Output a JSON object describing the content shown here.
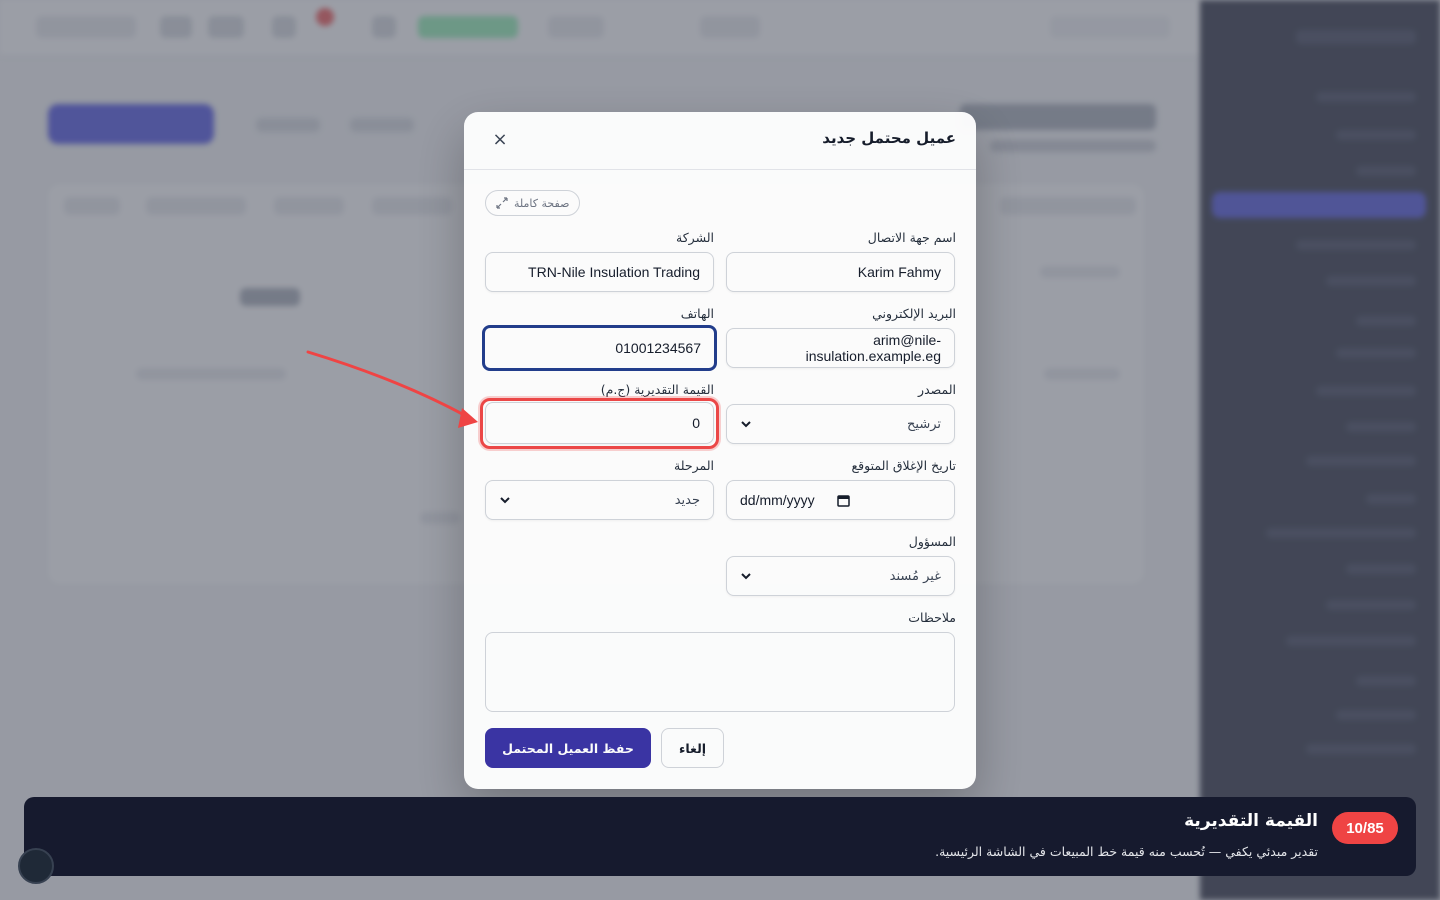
{
  "modal": {
    "title": "عميل محتمل جديد",
    "close_icon": "×",
    "fullpage_label": "صفحة كاملة",
    "fields": {
      "contact_name": {
        "label": "اسم جهة الاتصال",
        "value": "Karim Fahmy"
      },
      "company": {
        "label": "الشركة",
        "value": "TRN-Nile Insulation Trading"
      },
      "email": {
        "label": "البريد الإلكتروني",
        "value": "arim@nile-insulation.example.eg"
      },
      "phone": {
        "label": "الهاتف",
        "value": "01001234567"
      },
      "source": {
        "label": "المصدر",
        "value": "ترشيح"
      },
      "estimated_value": {
        "label": "القيمة التقديرية (ج.م)",
        "value": "0"
      },
      "expected_close": {
        "label": "تاريخ الإغلاق المتوقع",
        "placeholder": "dd/mm/yyyy"
      },
      "stage": {
        "label": "المرحلة",
        "value": "جديد"
      },
      "owner": {
        "label": "المسؤول",
        "value": "غير مُسند"
      },
      "notes": {
        "label": "ملاحظات",
        "value": ""
      }
    },
    "buttons": {
      "save": "حفظ العميل المحتمل",
      "cancel": "إلغاء"
    }
  },
  "tour": {
    "step": "10/85",
    "title": "القيمة التقديرية",
    "description": "تقدير مبدئي يكفي — تُحسب منه قيمة خط المبيعات في الشاشة الرئيسية."
  },
  "colors": {
    "accent": "#3730a3",
    "highlight": "#ef4444",
    "tour_bg": "#161a2e"
  }
}
